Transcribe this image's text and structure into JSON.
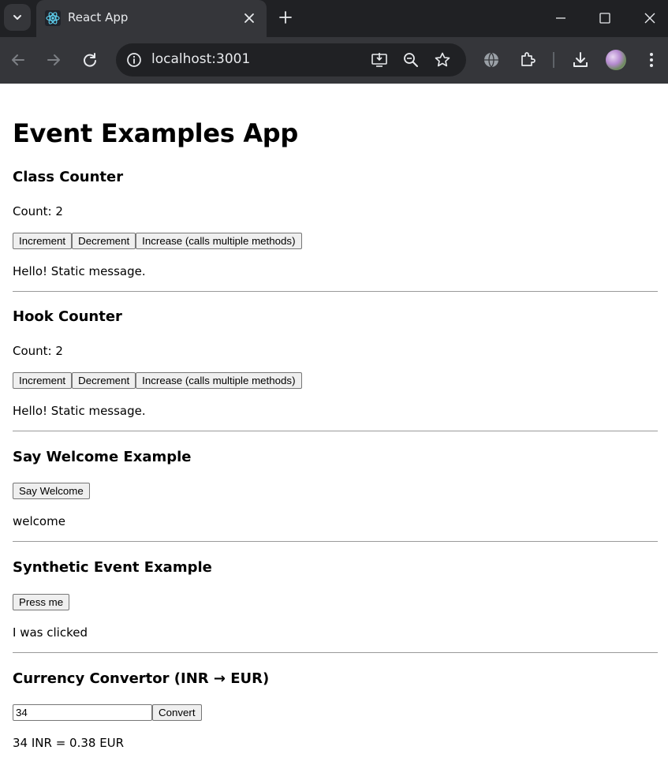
{
  "browser": {
    "tab_title": "React App",
    "url": "localhost:3001"
  },
  "app": {
    "title": "Event Examples App",
    "class_counter": {
      "heading": "Class Counter",
      "count_text": "Count: 2",
      "buttons": [
        "Increment",
        "Decrement",
        "Increase (calls multiple methods)"
      ],
      "message": "Hello! Static message."
    },
    "hook_counter": {
      "heading": "Hook Counter",
      "count_text": "Count: 2",
      "buttons": [
        "Increment",
        "Decrement",
        "Increase (calls multiple methods)"
      ],
      "message": "Hello! Static message."
    },
    "say_welcome": {
      "heading": "Say Welcome Example",
      "button": "Say Welcome",
      "output": "welcome"
    },
    "synthetic_event": {
      "heading": "Synthetic Event Example",
      "button": "Press me",
      "output": "I was clicked"
    },
    "currency": {
      "heading": "Currency Convertor (INR → EUR)",
      "input_value": "34",
      "button": "Convert",
      "result": "34 INR = 0.38 EUR"
    }
  },
  "icons": {
    "tab_search": "chevron-down-icon",
    "favicon": "react-logo-icon",
    "tab_close": "close-icon",
    "new_tab": "plus-icon",
    "minimize": "minimize-icon",
    "maximize": "maximize-icon",
    "close_window": "close-icon",
    "back": "back-arrow-icon",
    "forward": "forward-arrow-icon",
    "reload": "reload-icon",
    "site_info": "info-icon",
    "install": "install-app-icon",
    "zoom": "zoom-out-icon",
    "bookmark": "star-icon",
    "translate": "globe-icon",
    "extensions": "puzzle-icon",
    "downloads": "download-icon",
    "profile": "avatar",
    "menu": "kebab-menu-icon"
  },
  "colors": {
    "chrome_dark": "#202124",
    "chrome_toolbar": "#35363a",
    "chrome_text": "#e8eaed",
    "react_blue": "#61dafb"
  }
}
